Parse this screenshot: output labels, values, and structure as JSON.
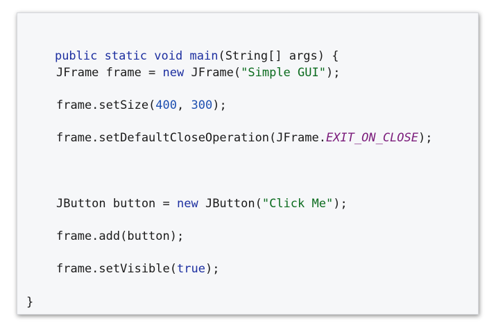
{
  "code": {
    "line1": {
      "kw_public": "public",
      "kw_static": "static",
      "kw_void": "void",
      "method": "main",
      "rest": "(String[] args) {"
    },
    "line2": {
      "decl": "JFrame frame = ",
      "kw_new": "new",
      "ctor": " JFrame(",
      "str": "\"Simple GUI\"",
      "end": ");"
    },
    "line3": {
      "call": "frame.setSize(",
      "num1": "400",
      "sep": ", ",
      "num2": "300",
      "end": ");"
    },
    "line4": {
      "call": "frame.setDefaultCloseOperation(JFrame.",
      "const": "EXIT_ON_CLOSE",
      "end": ");"
    },
    "line6": {
      "decl": "JButton button = ",
      "kw_new": "new",
      "ctor": " JButton(",
      "str": "\"Click Me\"",
      "end": ");"
    },
    "line7": {
      "text": "frame.add(button);"
    },
    "line8": {
      "call": "frame.setVisible(",
      "kw_true": "true",
      "end": ");"
    },
    "line9": {
      "text": "}"
    }
  }
}
